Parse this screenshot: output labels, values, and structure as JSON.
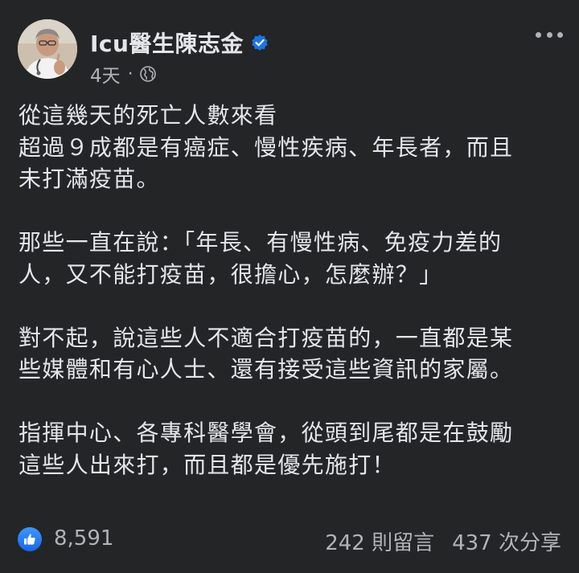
{
  "post": {
    "author": "Icu醫生陳志金",
    "time": "4天",
    "meta_separator": "·",
    "paragraphs": [
      {
        "lines": [
          "從這幾天的死亡人數來看",
          "超過９成都是有癌症、慢性疾病、年長者，而且",
          "未打滿疫苗。"
        ]
      },
      {
        "lines": [
          "那些一直在說：「年長、有慢性病、免疫力差的",
          "人，又不能打疫苗，很擔心，怎麼辦？」"
        ]
      },
      {
        "lines": [
          "對不起，說這些人不適合打疫苗的，一直都是某",
          "些媒體和有心人士、還有接受這些資訊的家屬。"
        ]
      },
      {
        "lines": [
          "指揮中心、各專科醫學會，從頭到尾都是在鼓勵",
          "這些人出來打，而且都是優先施打！"
        ]
      }
    ],
    "reactions": {
      "like_count": "8,591",
      "comments": "242 則留言",
      "shares": "437 次分享"
    }
  },
  "icons": {
    "avatar": "profile-photo",
    "verified": "verified-badge-icon",
    "audience": "globe-icon",
    "more": "more-options-icon",
    "like": "thumbs-up-icon"
  },
  "colors": {
    "background": "#242526",
    "primary_text": "#e4e6eb",
    "secondary_text": "#b0b3b8",
    "accent_blue": "#1b74e4"
  }
}
